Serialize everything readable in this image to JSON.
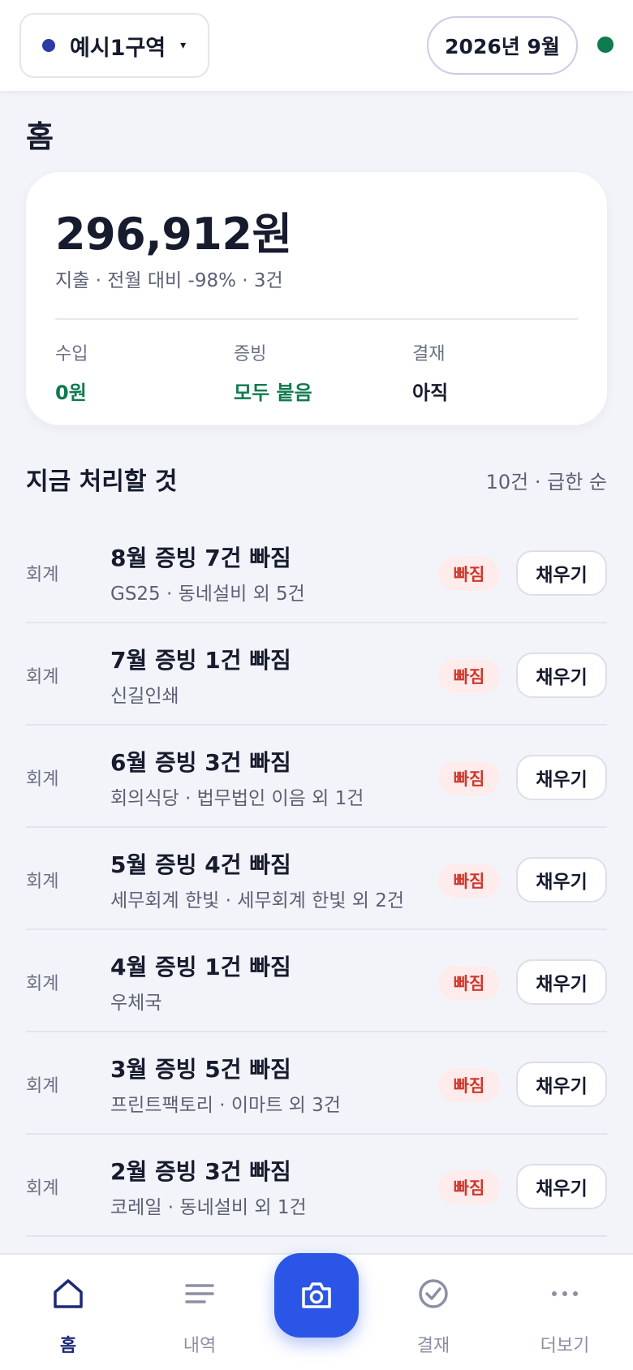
{
  "header": {
    "area_name": "예시1구역",
    "area_caret": "▾",
    "month": "2026년 9월",
    "area_dot_color": "#2e3aa6",
    "status_color": "#0e7a4e"
  },
  "page": {
    "title": "홈"
  },
  "summary": {
    "amount": "296,912원",
    "subtitle": "지출 · 전월 대비 -98% · 3건",
    "stats": [
      {
        "label": "수입",
        "value": "0원"
      },
      {
        "label": "증빙",
        "value": "모두 붙음"
      },
      {
        "label": "결재",
        "value": "아직"
      }
    ]
  },
  "tasks": {
    "title": "지금 처리할 것",
    "meta": "10건 · 급한 순",
    "items": [
      {
        "category": "회계",
        "title": "8월 증빙 7건 빠짐",
        "sub": "GS25 · 동네설비 외 5건",
        "badge": "빠짐",
        "action": "채우기"
      },
      {
        "category": "회계",
        "title": "7월 증빙 1건 빠짐",
        "sub": "신길인쇄",
        "badge": "빠짐",
        "action": "채우기"
      },
      {
        "category": "회계",
        "title": "6월 증빙 3건 빠짐",
        "sub": "회의식당 · 법무법인 이음 외 1건",
        "badge": "빠짐",
        "action": "채우기"
      },
      {
        "category": "회계",
        "title": "5월 증빙 4건 빠짐",
        "sub": "세무회계 한빛 · 세무회계 한빛 외 2건",
        "badge": "빠짐",
        "action": "채우기"
      },
      {
        "category": "회계",
        "title": "4월 증빙 1건 빠짐",
        "sub": "우체국",
        "badge": "빠짐",
        "action": "채우기"
      },
      {
        "category": "회계",
        "title": "3월 증빙 5건 빠짐",
        "sub": "프린트팩토리 · 이마트 외 3건",
        "badge": "빠짐",
        "action": "채우기"
      },
      {
        "category": "회계",
        "title": "2월 증빙 3건 빠짐",
        "sub": "코레일 · 동네설비 외 1건",
        "badge": "빠짐",
        "action": "채우기"
      }
    ]
  },
  "nav": {
    "items": [
      {
        "label": "홈",
        "icon": "home-icon"
      },
      {
        "label": "내역",
        "icon": "list-icon"
      },
      {
        "label": "",
        "icon": "camera-icon"
      },
      {
        "label": "결재",
        "icon": "check-circle-icon"
      },
      {
        "label": "더보기",
        "icon": "more-dots-icon"
      }
    ]
  }
}
